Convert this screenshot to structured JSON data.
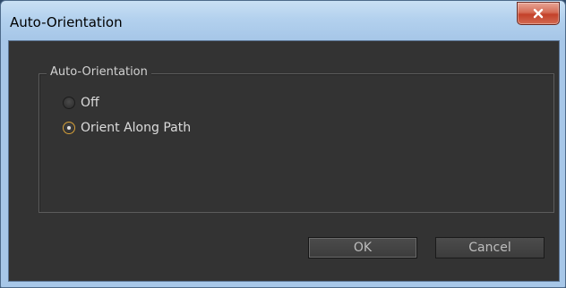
{
  "window": {
    "title": "Auto-Orientation",
    "close_icon": "close-icon"
  },
  "group": {
    "legend": "Auto-Orientation",
    "options": [
      {
        "label": "Off",
        "selected": false
      },
      {
        "label": "Orient Along Path",
        "selected": true
      }
    ]
  },
  "buttons": {
    "ok_label": "OK",
    "cancel_label": "Cancel"
  },
  "colors": {
    "client_bg": "#333333",
    "radio_selected_ring": "#d6a13a",
    "close_button": "#c3412a"
  }
}
